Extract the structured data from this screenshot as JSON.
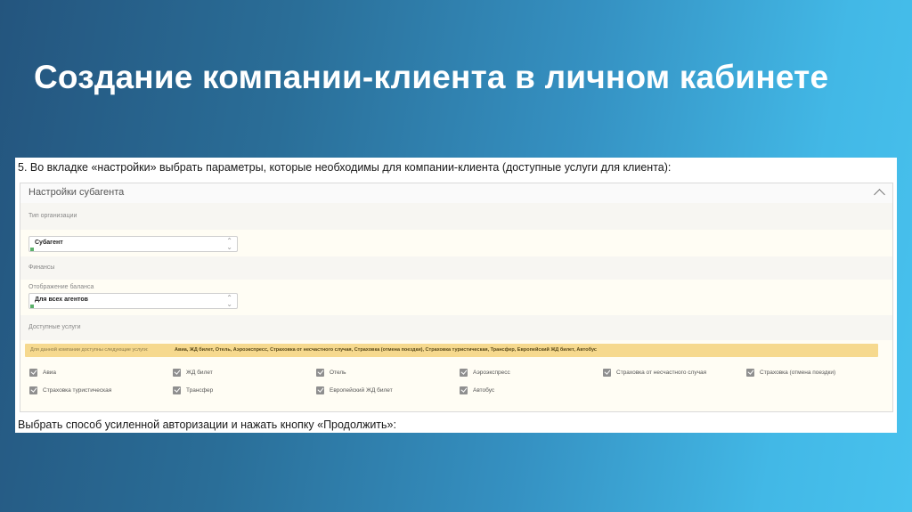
{
  "slide": {
    "title": "Создание компании-клиента в личном кабинете"
  },
  "screenshot": {
    "step_text": "5. Во вкладке «настройки» выбрать параметры, которые необходимы для компании-клиента (доступные услуги для клиента):",
    "panel_title": "Настройки субагента",
    "org_type_label": "Тип организации",
    "org_type_value": "Субагент",
    "finance_label": "Финансы",
    "balance_label": "Отображение баланса",
    "balance_value": "Для всех агентов",
    "services_label": "Доступные услуги",
    "notice_prefix": "Для данной компании доступны следующие услуги:",
    "notice_services": "Авиа, ЖД билет, Отель, Аэроэкспресс, Страховка от несчастного случая, Страховка (отмена поездки), Страховка туристическая, Трансфер, Европейский ЖД билет, Автобус",
    "services": [
      "Авиа",
      "ЖД билет",
      "Отель",
      "Аэроэкспресс",
      "Страховка от несчастного случая",
      "Страховка (отмена поездки)",
      "Страховка туристическая",
      "Трансфер",
      "Европейский ЖД билет",
      "Автобус"
    ],
    "footer_text": "Выбрать способ усиленной авторизации и нажать кнопку «Продолжить»:"
  },
  "colors": {
    "notice_bg": "#f6d98e",
    "panel_bg": "#fffdf4",
    "checkbox": "#8f8f8f"
  },
  "icons": {
    "collapse": "chevron-up-icon",
    "select": "updown-arrows-icon",
    "checkbox": "checkmark-icon"
  }
}
